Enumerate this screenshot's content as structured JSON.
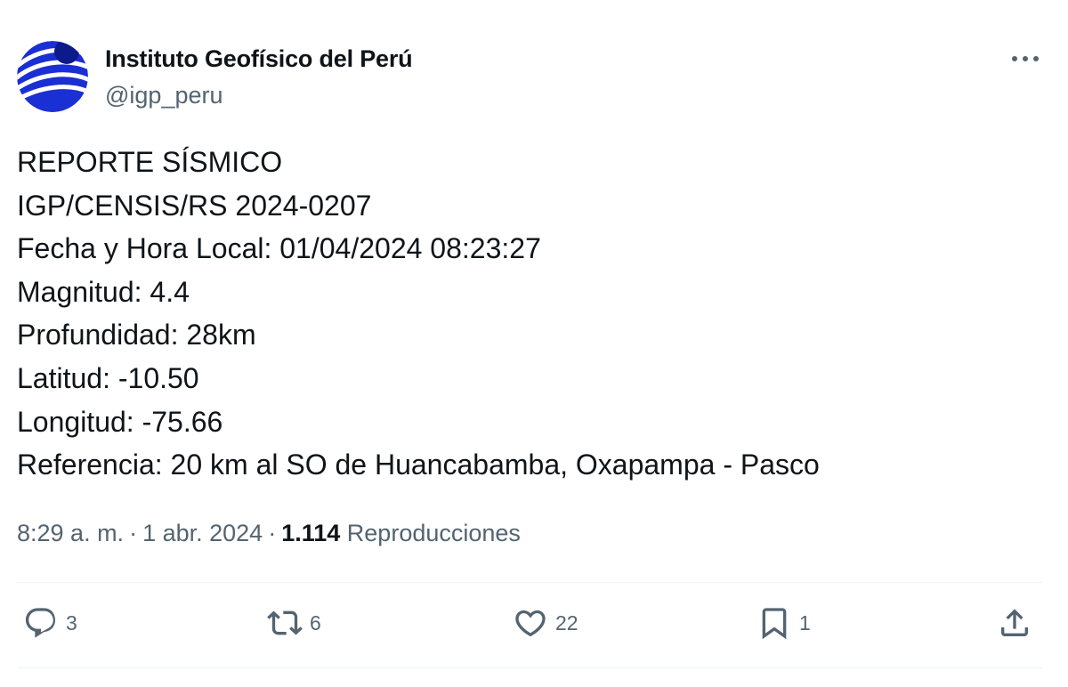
{
  "author": {
    "display_name": "Instituto Geofísico del Perú",
    "handle": "@igp_peru",
    "avatar_icon": "igp-logo-icon"
  },
  "tweet": {
    "lines": [
      "REPORTE SÍSMICO",
      "IGP/CENSIS/RS 2024-0207",
      "Fecha y Hora Local: 01/04/2024 08:23:27",
      "Magnitud: 4.4",
      "Profundidad: 28km",
      "Latitud: -10.50",
      "Longitud: -75.66",
      "Referencia: 20 km al SO de Huancabamba, Oxapampa - Pasco"
    ],
    "time": "8:29 a. m.",
    "date": "1 abr. 2024",
    "views_count": "1.114",
    "views_label": "Reproducciones"
  },
  "actions": {
    "reply": {
      "count": "3",
      "icon": "reply-icon"
    },
    "retweet": {
      "count": "6",
      "icon": "retweet-icon"
    },
    "like": {
      "count": "22",
      "icon": "heart-icon"
    },
    "bookmark": {
      "count": "1",
      "icon": "bookmark-icon"
    },
    "share": {
      "icon": "share-icon"
    }
  },
  "more_icon": "more-icon",
  "colors": {
    "text": "#0f1419",
    "secondary": "#536471",
    "divider": "#eff3f4",
    "logo_blue": "#1a2fd4"
  }
}
